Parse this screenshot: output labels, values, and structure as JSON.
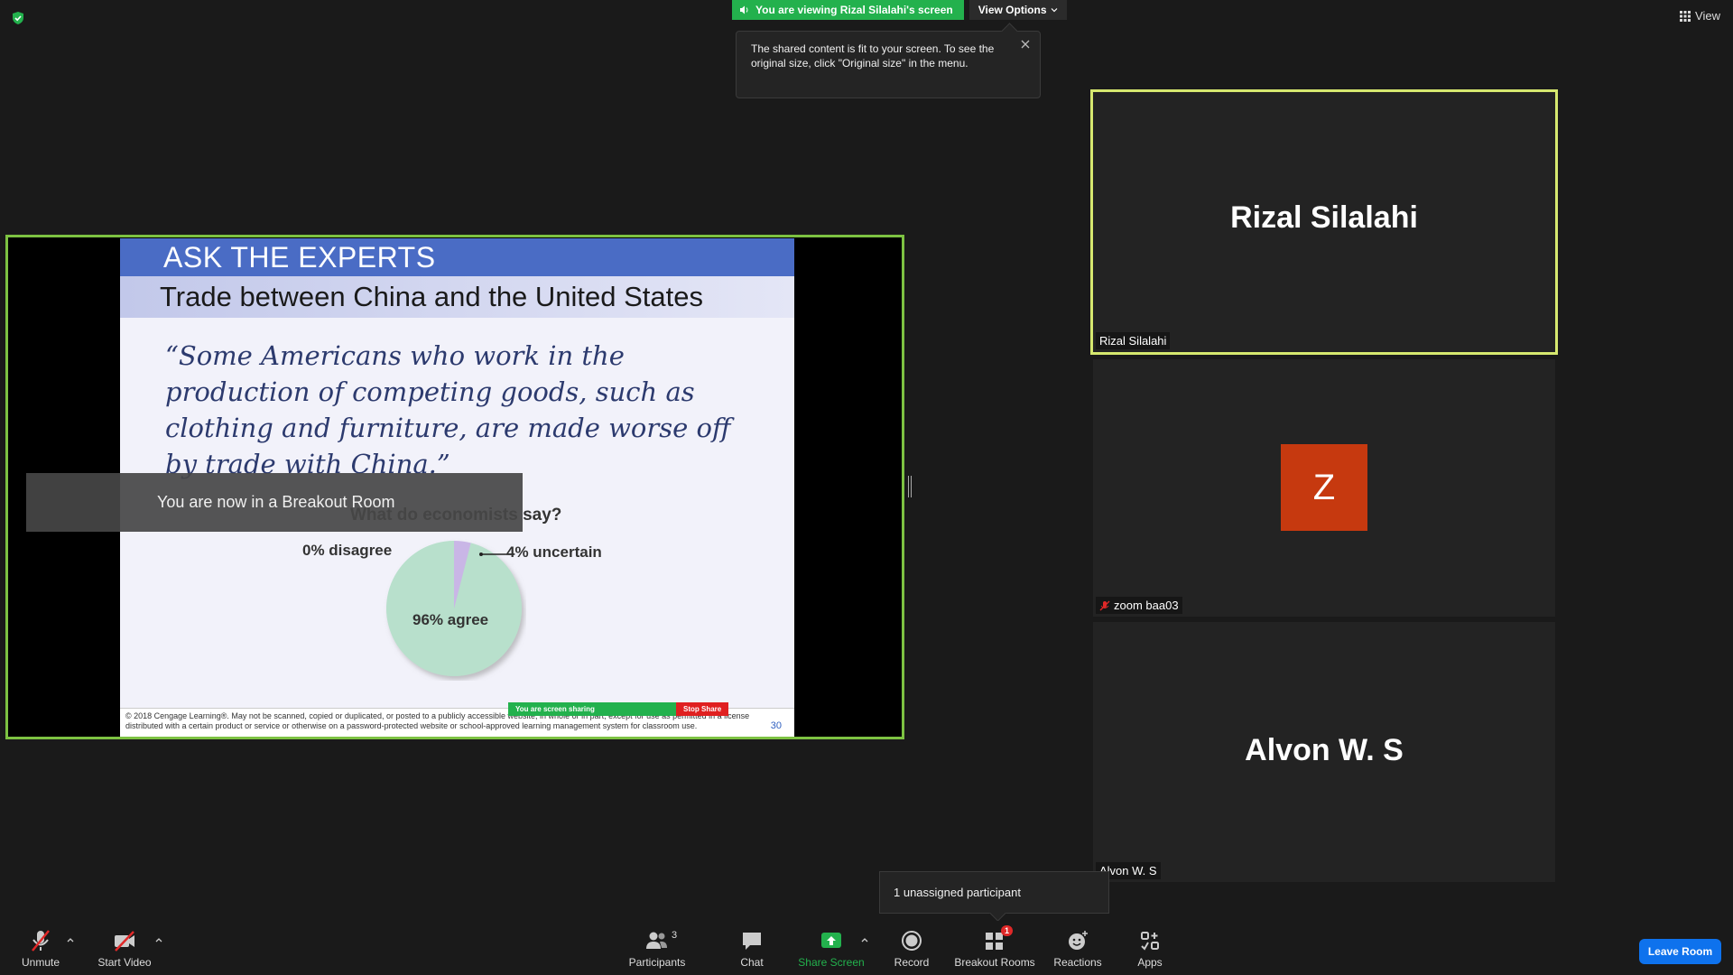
{
  "top": {
    "viewing_banner": "You are viewing Rizal Silalahi's screen",
    "view_options": "View Options",
    "view_label": "View",
    "fit_tooltip": "The shared content is fit to your screen. To see the original size, click \"Original size\" in the menu."
  },
  "slide": {
    "title": "ASK THE EXPERTS",
    "subtitle": "Trade between China and the United States",
    "quote": "“Some Americans who work in the production of competing goods, such as clothing and furniture, are made worse off by trade with China.”",
    "question": "What do economists say?",
    "label_disagree": "0% disagree",
    "label_uncertain": "4% uncertain",
    "label_agree": "96% agree",
    "copyright": "© 2018 Cengage Learning®. May not be scanned, copied or duplicated, or posted to a publicly accessible website, in whole or in part, except for use as permitted in a license distributed with a certain product or service or otherwise on a password-protected website or school-approved learning management system for classroom use.",
    "page_number": "30",
    "mini_sharing": "You are screen sharing",
    "mini_stop": "Stop Share",
    "pie_values": {
      "agree": 96,
      "uncertain": 4,
      "disagree": 0
    },
    "colors": {
      "agree": "#b8e0cc",
      "uncertain": "#c9b6e6"
    }
  },
  "breakout_toast": "You are now in a Breakout Room",
  "participants": [
    {
      "big_name": "Rizal Silalahi",
      "label": "Rizal Silalahi"
    },
    {
      "avatar_letter": "Z",
      "label": "zoom baa03"
    },
    {
      "big_name": "Alvon W. S",
      "label": "Alvon W. S"
    }
  ],
  "unassigned": "1 unassigned participant",
  "toolbar": {
    "unmute": "Unmute",
    "start_video": "Start Video",
    "participants": "Participants",
    "participants_count": "3",
    "chat": "Chat",
    "share_screen": "Share Screen",
    "record": "Record",
    "breakout_rooms": "Breakout Rooms",
    "breakout_badge": "1",
    "reactions": "Reactions",
    "apps": "Apps",
    "leave_room": "Leave Room"
  }
}
